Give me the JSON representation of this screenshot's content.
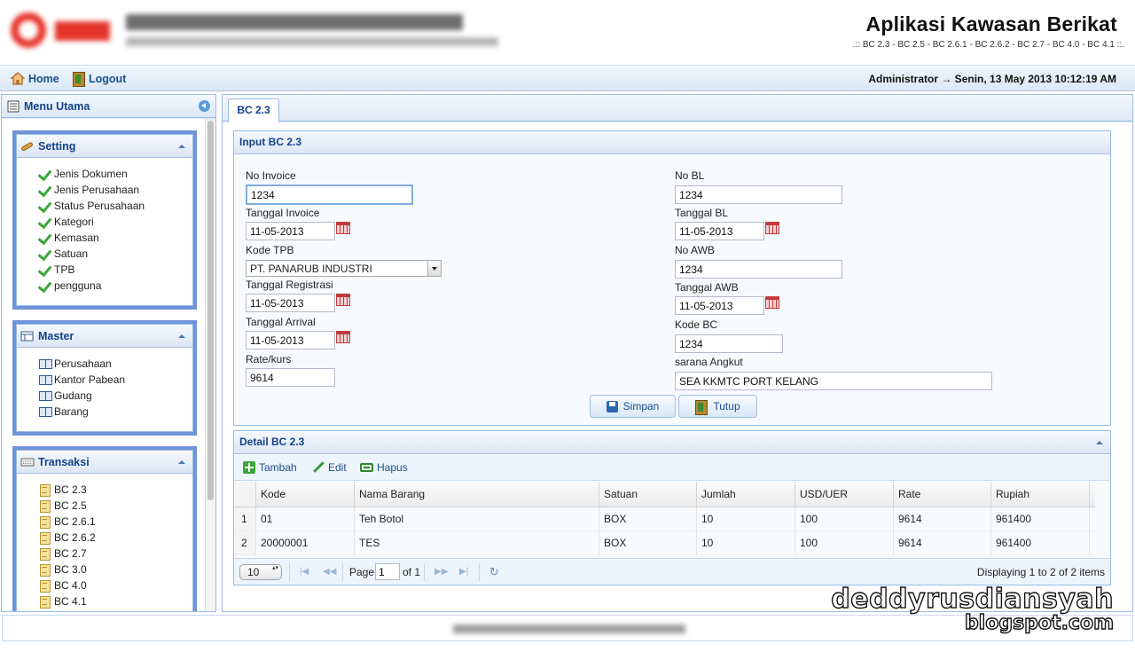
{
  "app": {
    "title": "Aplikasi Kawasan Berikat",
    "subtitle": ".:: BC 2.3 - BC 2.5 - BC 2.6.1 - BC 2.6.2 - BC 2.7 - BC 4.0 - BC 4.1 ::."
  },
  "nav": {
    "home": "Home",
    "logout": "Logout",
    "user_info": "Administrator → Senin, 13 May 2013 10:12:19 AM"
  },
  "menu": {
    "title": "Menu Utama",
    "setting": {
      "title": "Setting",
      "items": [
        "Jenis Dokumen",
        "Jenis Perusahaan",
        "Status Perusahaan",
        "Kategori",
        "Kemasan",
        "Satuan",
        "TPB",
        "pengguna"
      ]
    },
    "master": {
      "title": "Master",
      "items": [
        "Perusahaan",
        "Kantor Pabean",
        "Gudang",
        "Barang"
      ]
    },
    "transaksi": {
      "title": "Transaksi",
      "items": [
        "BC 2.3",
        "BC 2.5",
        "BC 2.6.1",
        "BC 2.6.2",
        "BC 2.7",
        "BC 3.0",
        "BC 4.0",
        "BC 4.1"
      ]
    }
  },
  "tab": {
    "label": "BC 2.3"
  },
  "form": {
    "title": "Input BC 2.3",
    "no_invoice": {
      "label": "No Invoice",
      "value": "1234"
    },
    "tanggal_invoice": {
      "label": "Tanggal Invoice",
      "value": "11-05-2013"
    },
    "kode_tpb": {
      "label": "Kode TPB",
      "value": "PT. PANARUB INDUSTRI"
    },
    "tanggal_registrasi": {
      "label": "Tanggal Registrasi",
      "value": "11-05-2013"
    },
    "tanggal_arrival": {
      "label": "Tanggal Arrival",
      "value": "11-05-2013"
    },
    "rate_kurs": {
      "label": "Rate/kurs",
      "value": "9614"
    },
    "no_bl": {
      "label": "No BL",
      "value": "1234"
    },
    "tanggal_bl": {
      "label": "Tanggal BL",
      "value": "11-05-2013"
    },
    "no_awb": {
      "label": "No AWB",
      "value": "1234"
    },
    "tanggal_awb": {
      "label": "Tanggal AWB",
      "value": "11-05-2013"
    },
    "kode_bc": {
      "label": "Kode BC",
      "value": "1234"
    },
    "sarana_angkut": {
      "label": "sarana Angkut",
      "value": "SEA KKMTC PORT KELANG"
    },
    "save_label": "Simpan",
    "close_label": "Tutup"
  },
  "detail": {
    "title": "Detail BC 2.3",
    "toolbar": {
      "add": "Tambah",
      "edit": "Edit",
      "delete": "Hapus"
    },
    "columns": [
      "Kode",
      "Nama Barang",
      "Satuan",
      "Jumlah",
      "USD/UER",
      "Rate",
      "Rupiah"
    ],
    "rows": [
      {
        "no": "1",
        "kode": "01",
        "nama": "Teh Botol",
        "satuan": "BOX",
        "jumlah": "10",
        "usd": "100",
        "rate": "9614",
        "rupiah": "961400"
      },
      {
        "no": "2",
        "kode": "20000001",
        "nama": "TES",
        "satuan": "BOX",
        "jumlah": "10",
        "usd": "100",
        "rate": "9614",
        "rupiah": "961400"
      }
    ],
    "pager": {
      "page_size": "10",
      "page_label": "Page",
      "page_value": "1",
      "of_label": "of 1",
      "display": "Displaying 1 to 2 of 2 items"
    }
  },
  "watermark": {
    "line1": "deddyrusdiansyah",
    "line2": "blogspot.com"
  }
}
